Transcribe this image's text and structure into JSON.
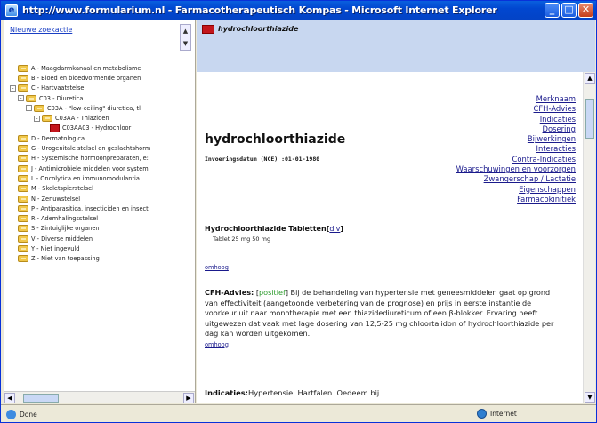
{
  "window": {
    "title": "http://www.formularium.nl - Farmacotherapeutisch Kompas - Microsoft Internet Explorer",
    "buttons": [
      "_",
      "□",
      "✕"
    ]
  },
  "sidebar": {
    "new_search": "Nieuwe zoekactie",
    "tree": [
      {
        "label": "A - Maagdarmkanaal en metabolisme",
        "level": 0,
        "expander": "",
        "kind": "folder"
      },
      {
        "label": "B - Bloed en bloedvormende organen",
        "level": 0,
        "expander": "",
        "kind": "folder"
      },
      {
        "label": "C - Hartvaatstelsel",
        "level": 0,
        "expander": "-",
        "kind": "folder"
      },
      {
        "label": "C03 - Diuretica",
        "level": 1,
        "expander": "-",
        "kind": "folder"
      },
      {
        "label": "C03A - \"low-ceiling\" diuretica, tl",
        "level": 2,
        "expander": "-",
        "kind": "folder"
      },
      {
        "label": "C03AA - Thiaziden",
        "level": 3,
        "expander": "-",
        "kind": "folder"
      },
      {
        "label": "C03AA03 - Hydrochloor",
        "level": 4,
        "expander": "",
        "kind": "doc"
      },
      {
        "label": "D - Dermatologica",
        "level": 0,
        "expander": "",
        "kind": "folder"
      },
      {
        "label": "G - Urogenitale stelsel en geslachtshorm",
        "level": 0,
        "expander": "",
        "kind": "folder"
      },
      {
        "label": "H - Systemische hormoonpreparaten, e:",
        "level": 0,
        "expander": "",
        "kind": "folder"
      },
      {
        "label": "J - Antimicrobiele middelen voor systemi",
        "level": 0,
        "expander": "",
        "kind": "folder"
      },
      {
        "label": "L - Oncolytica en immunomodulantia",
        "level": 0,
        "expander": "",
        "kind": "folder"
      },
      {
        "label": "M - Skeletspierstelsel",
        "level": 0,
        "expander": "",
        "kind": "folder"
      },
      {
        "label": "N - Zenuwstelsel",
        "level": 0,
        "expander": "",
        "kind": "folder"
      },
      {
        "label": "P - Antiparasitica, insecticiden en insect",
        "level": 0,
        "expander": "",
        "kind": "folder"
      },
      {
        "label": "R - Ademhalingsstelsel",
        "level": 0,
        "expander": "",
        "kind": "folder"
      },
      {
        "label": "S - Zintuiglijke organen",
        "level": 0,
        "expander": "",
        "kind": "folder"
      },
      {
        "label": "V - Diverse middelen",
        "level": 0,
        "expander": "",
        "kind": "folder"
      },
      {
        "label": "Y - Niet ingevuld",
        "level": 0,
        "expander": "",
        "kind": "folder"
      },
      {
        "label": "Z - Niet van toepassing",
        "level": 0,
        "expander": "",
        "kind": "folder"
      }
    ]
  },
  "main": {
    "banner_title": "hydrochloorthiazide",
    "heading": "hydrochloorthiazide",
    "intro_date": "Invoeringsdatum (NCE) :01-01-1980",
    "links": [
      "Merknaam",
      "CFH-Advies",
      "Indicaties",
      "Dosering",
      "Bijwerkingen",
      "Interacties",
      "Contra-Indicaties",
      "Waarschuwingen en voorzorgen",
      "Zwangerschap / Lactatie",
      "Eigenschappen",
      "Farmacokinitiek"
    ],
    "product_title": "Hydrochloorthiazide Tabletten",
    "product_link": "div",
    "product_dose": "Tablet 25 mg 50 mg",
    "back_to_top": "omhoog",
    "cfh_label": "CFH-Advies:",
    "cfh_tag": "positief",
    "cfh_text": "Bij de behandeling van hypertensie met geneesmiddelen gaat op grond van effectiviteit (aangetoonde verbetering van de prognose) en prijs in eerste instantie de voorkeur uit naar monotherapie met een thiazidediureticum of een β-blokker. Ervaring heeft uitgewezen dat vaak met lage dosering van 12,5-25 mg chloortalidon of hydrochloorthiazide per dag kan worden uitgekomen.",
    "indications_label": "Indicaties:",
    "indications_text": "Hypertensie. Hartfalen. Oedeem bij"
  },
  "status": {
    "text": "Done",
    "zone": "Internet"
  }
}
